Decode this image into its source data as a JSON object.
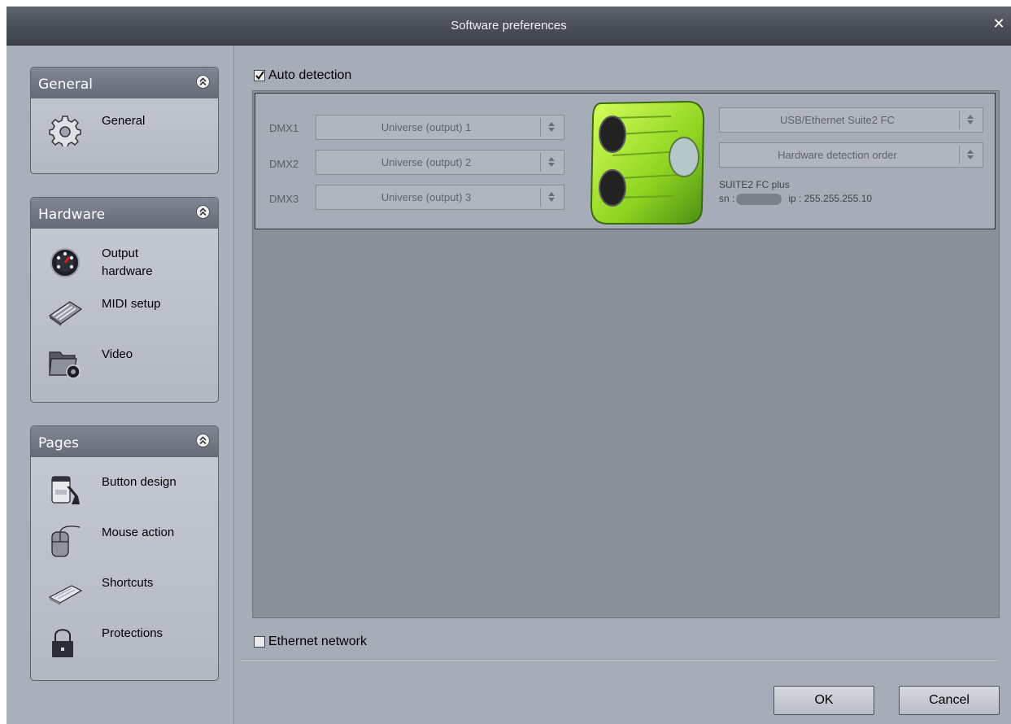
{
  "window": {
    "title": "Software preferences",
    "close_glyph": "✕"
  },
  "sidebar": {
    "panels": [
      {
        "title": "General",
        "items": [
          {
            "label": "General",
            "icon": "gear-icon"
          }
        ]
      },
      {
        "title": "Hardware",
        "items": [
          {
            "label": "Output\nhardware",
            "icon": "output-hardware-icon"
          },
          {
            "label": "MIDI setup",
            "icon": "midi-keyboard-icon"
          },
          {
            "label": "Video",
            "icon": "video-folder-icon"
          }
        ]
      },
      {
        "title": "Pages",
        "items": [
          {
            "label": "Button design",
            "icon": "paint-bucket-icon"
          },
          {
            "label": "Mouse action",
            "icon": "mouse-icon"
          },
          {
            "label": "Shortcuts",
            "icon": "keyboard-icon"
          },
          {
            "label": "Protections",
            "icon": "padlock-icon"
          }
        ]
      }
    ]
  },
  "main": {
    "auto_detection": {
      "label": "Auto detection",
      "checked": true
    },
    "device": {
      "dmx": [
        {
          "label": "DMX1",
          "value": "Universe (output) 1"
        },
        {
          "label": "DMX2",
          "value": "Universe (output) 2"
        },
        {
          "label": "DMX3",
          "value": "Universe (output) 3"
        }
      ],
      "interface_select": "USB/Ethernet Suite2 FC",
      "order_select": "Hardware detection order",
      "model": "SUITE2 FC plus",
      "sn_label": "sn :",
      "ip_label": "ip : 255.255.255.10"
    },
    "ethernet_network": {
      "label": "Ethernet network",
      "checked": false
    },
    "buttons": {
      "ok": "OK",
      "cancel": "Cancel"
    }
  },
  "colors": {
    "window_bg": "#a6acb8",
    "panel_header": "#6f7581",
    "device_area": "#8a8f98",
    "device_green": "#9fe02a"
  }
}
